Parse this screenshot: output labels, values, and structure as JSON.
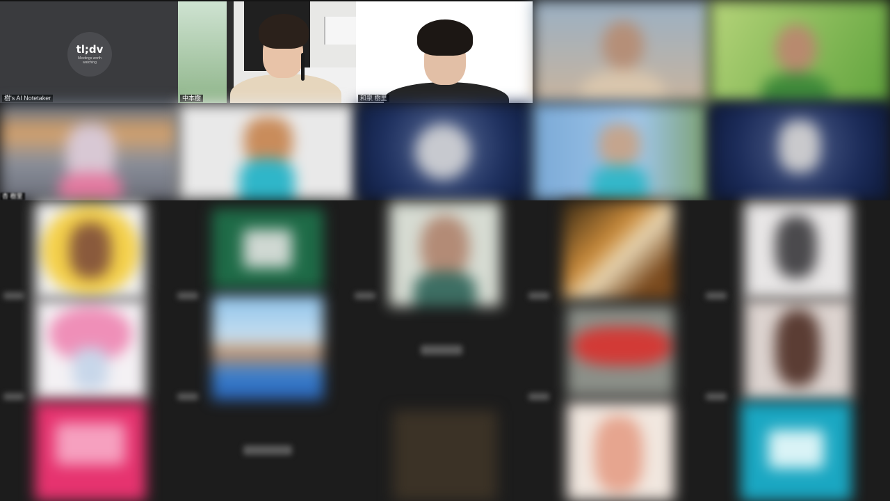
{
  "participants": {
    "notetaker": {
      "name": "樹's AI Notetaker",
      "logo_text": "tl;dv",
      "logo_tagline": "Meetings worth watching"
    },
    "speaker_1": {
      "name": "中本樹"
    },
    "speaker_2": {
      "name": "和泉 樹里"
    },
    "blurred_label": "杏 樹里"
  },
  "colors": {
    "background": "#141414",
    "notetaker_tile": "#3a3b3e",
    "label_bg": "#000000"
  }
}
